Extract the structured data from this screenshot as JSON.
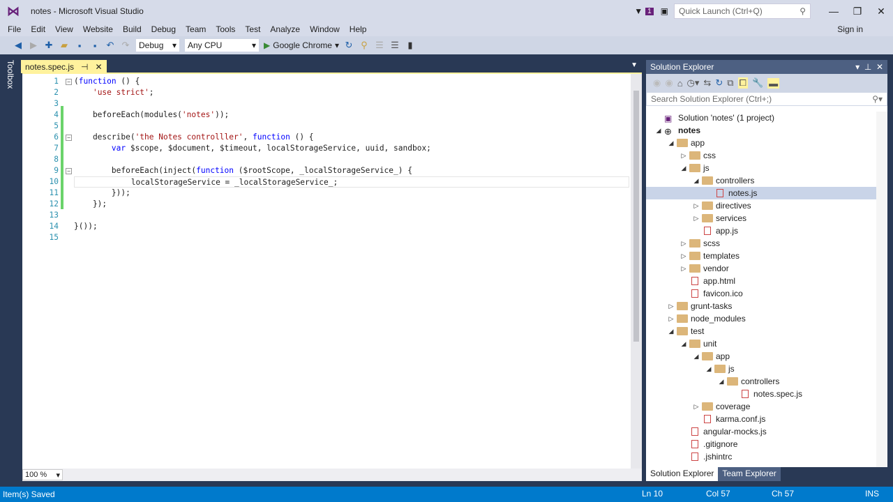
{
  "window": {
    "title": "notes - Microsoft Visual Studio",
    "quick_launch": "Quick Launch (Ctrl+Q)",
    "notif_count": "1",
    "sign_in": "Sign in"
  },
  "menu": [
    "File",
    "Edit",
    "View",
    "Website",
    "Build",
    "Debug",
    "Team",
    "Tools",
    "Test",
    "Analyze",
    "Window",
    "Help"
  ],
  "toolbar": {
    "config": "Debug",
    "platform": "Any CPU",
    "run_target": "Google Chrome"
  },
  "toolbox": "Toolbox",
  "tab": {
    "name": "notes.spec.js",
    "pin": "⊣",
    "close": "✕"
  },
  "code": [
    [
      [
        "(",
        ""
      ],
      [
        "function",
        "kw"
      ],
      [
        " () {",
        ""
      ]
    ],
    [
      [
        "    ",
        ""
      ],
      [
        "'use strict'",
        "st"
      ],
      [
        ";",
        ""
      ]
    ],
    [],
    [
      [
        "    beforeEach(modules(",
        ""
      ],
      [
        "'notes'",
        "st"
      ],
      [
        "));",
        ""
      ]
    ],
    [],
    [
      [
        "    describe(",
        ""
      ],
      [
        "'the Notes controlller'",
        "st"
      ],
      [
        ", ",
        ""
      ],
      [
        "function",
        "kw"
      ],
      [
        " () {",
        ""
      ]
    ],
    [
      [
        "        ",
        ""
      ],
      [
        "var",
        "kw"
      ],
      [
        " $scope, $document, $timeout, localStorageService, uuid, sandbox;",
        ""
      ]
    ],
    [],
    [
      [
        "        beforeEach(inject(",
        ""
      ],
      [
        "function",
        "kw"
      ],
      [
        " ($rootScope, _localStorageService_) {",
        ""
      ]
    ],
    [
      [
        "            localStorageService = _localStorageService_;",
        ""
      ]
    ],
    [
      [
        "        }));",
        ""
      ]
    ],
    [
      [
        "    });",
        ""
      ]
    ],
    [],
    [
      [
        "}());",
        ""
      ]
    ],
    []
  ],
  "zoom": "100 %",
  "solution_explorer": {
    "title": "Solution Explorer",
    "search_placeholder": "Search Solution Explorer (Ctrl+;)",
    "items": [
      {
        "label": "Solution 'notes' (1 project)",
        "level": 0,
        "arrow": "",
        "icon": "solution"
      },
      {
        "label": "notes",
        "level": 0,
        "arrow": "◢",
        "icon": "globe",
        "bold": true
      },
      {
        "label": "app",
        "level": 1,
        "arrow": "◢",
        "icon": "folder"
      },
      {
        "label": "css",
        "level": 2,
        "arrow": "▷",
        "icon": "folder"
      },
      {
        "label": "js",
        "level": 2,
        "arrow": "◢",
        "icon": "folder"
      },
      {
        "label": "controllers",
        "level": 3,
        "arrow": "◢",
        "icon": "folder"
      },
      {
        "label": "notes.js",
        "level": 4,
        "arrow": "",
        "icon": "file",
        "selected": true
      },
      {
        "label": "directives",
        "level": 3,
        "arrow": "▷",
        "icon": "folder"
      },
      {
        "label": "services",
        "level": 3,
        "arrow": "▷",
        "icon": "folder"
      },
      {
        "label": "app.js",
        "level": 3,
        "arrow": "",
        "icon": "file"
      },
      {
        "label": "scss",
        "level": 2,
        "arrow": "▷",
        "icon": "folder"
      },
      {
        "label": "templates",
        "level": 2,
        "arrow": "▷",
        "icon": "folder"
      },
      {
        "label": "vendor",
        "level": 2,
        "arrow": "▷",
        "icon": "folder"
      },
      {
        "label": "app.html",
        "level": 2,
        "arrow": "",
        "icon": "file"
      },
      {
        "label": "favicon.ico",
        "level": 2,
        "arrow": "",
        "icon": "file"
      },
      {
        "label": "grunt-tasks",
        "level": 1,
        "arrow": "▷",
        "icon": "folder"
      },
      {
        "label": "node_modules",
        "level": 1,
        "arrow": "▷",
        "icon": "folder"
      },
      {
        "label": "test",
        "level": 1,
        "arrow": "◢",
        "icon": "folder"
      },
      {
        "label": "unit",
        "level": 2,
        "arrow": "◢",
        "icon": "folder"
      },
      {
        "label": "app",
        "level": 3,
        "arrow": "◢",
        "icon": "folder"
      },
      {
        "label": "js",
        "level": 4,
        "arrow": "◢",
        "icon": "folder"
      },
      {
        "label": "controllers",
        "level": 5,
        "arrow": "◢",
        "icon": "folder"
      },
      {
        "label": "notes.spec.js",
        "level": 6,
        "arrow": "",
        "icon": "file"
      },
      {
        "label": "coverage",
        "level": 3,
        "arrow": "▷",
        "icon": "folder"
      },
      {
        "label": "karma.conf.js",
        "level": 3,
        "arrow": "",
        "icon": "file"
      },
      {
        "label": "angular-mocks.js",
        "level": 2,
        "arrow": "",
        "icon": "file"
      },
      {
        "label": ".gitignore",
        "level": 2,
        "arrow": "",
        "icon": "file"
      },
      {
        "label": ".jshintrc",
        "level": 2,
        "arrow": "",
        "icon": "file"
      }
    ],
    "tabs": [
      "Solution Explorer",
      "Team Explorer"
    ]
  },
  "status": {
    "message": "Item(s) Saved",
    "line": "Ln 10",
    "col": "Col 57",
    "ch": "Ch 57",
    "mode": "INS"
  }
}
